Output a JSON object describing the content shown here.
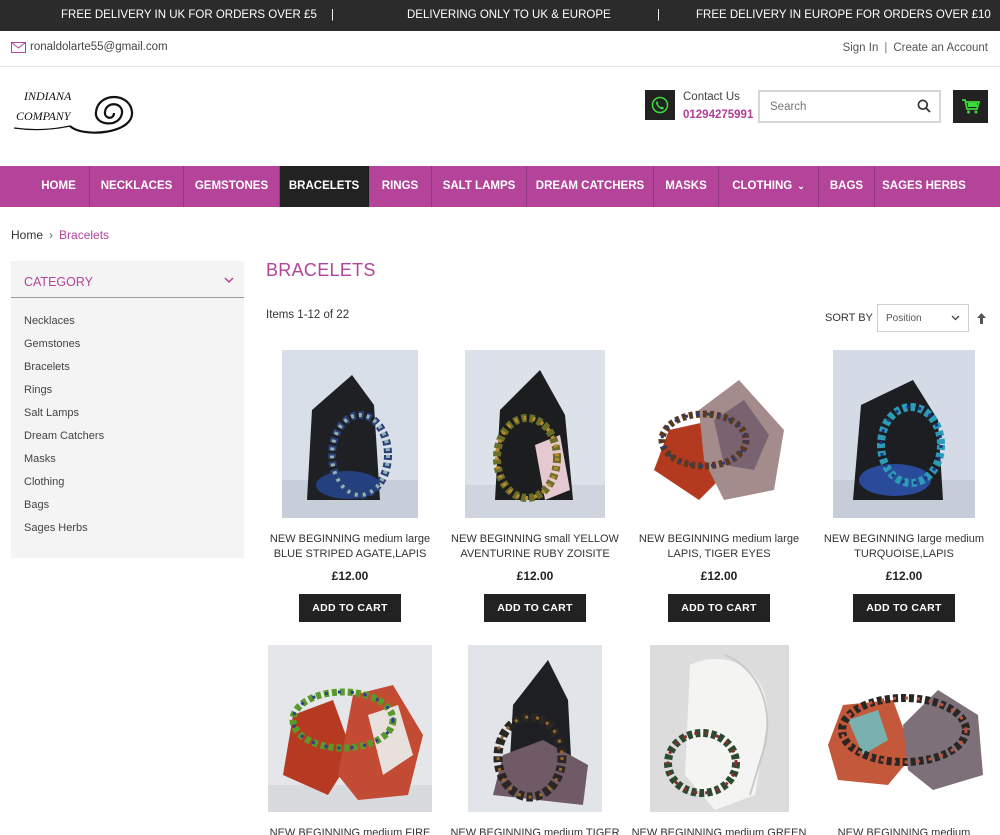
{
  "promo": {
    "left": "FREE DELIVERY IN UK FOR ORDERS OVER £5",
    "sep1": "|",
    "center": "DELIVERING ONLY TO UK & EUROPE",
    "sep2": "|",
    "right": "FREE DELIVERY IN EUROPE FOR ORDERS OVER £10"
  },
  "top": {
    "email": "ronaldolarte55@gmail.com",
    "sign_in": "Sign In",
    "sep": "|",
    "create_account": "Create an Account"
  },
  "header": {
    "contact_label": "Contact Us",
    "contact_phone": "01294275991",
    "search_placeholder": "Search"
  },
  "nav": [
    {
      "label": "HOME",
      "name": "nav-home"
    },
    {
      "label": "NECKLACES",
      "name": "nav-necklaces"
    },
    {
      "label": "GEMSTONES",
      "name": "nav-gemstones"
    },
    {
      "label": "BRACELETS",
      "name": "nav-bracelets",
      "active": true
    },
    {
      "label": "RINGS",
      "name": "nav-rings"
    },
    {
      "label": "SALT LAMPS",
      "name": "nav-salt-lamps"
    },
    {
      "label": "DREAM CATCHERS",
      "name": "nav-dream-catchers"
    },
    {
      "label": "MASKS",
      "name": "nav-masks"
    },
    {
      "label": "CLOTHING",
      "name": "nav-clothing",
      "dropdown": true
    },
    {
      "label": "BAGS",
      "name": "nav-bags"
    },
    {
      "label": "SAGES HERBS",
      "name": "nav-sages-herbs"
    }
  ],
  "breadcrumb": {
    "home": "Home",
    "current": "Bracelets"
  },
  "sidebar": {
    "title": "CATEGORY",
    "items": [
      "Necklaces",
      "Gemstones",
      "Bracelets",
      "Rings",
      "Salt Lamps",
      "Dream Catchers",
      "Masks",
      "Clothing",
      "Bags",
      "Sages Herbs"
    ]
  },
  "main": {
    "title": "BRACELETS",
    "items_count": "Items 1-12 of 22",
    "sort_label": "SORT BY",
    "sort_value": "Position"
  },
  "products": [
    {
      "name_line1": "NEW BEGINNING medium large",
      "name_line2": "BLUE STRIPED AGATE,LAPIS",
      "price": "£12.00",
      "cta": "ADD TO CART"
    },
    {
      "name_line1": "NEW BEGINNING small YELLOW",
      "name_line2": "AVENTURINE RUBY ZOISITE",
      "price": "£12.00",
      "cta": "ADD TO CART"
    },
    {
      "name_line1": "NEW BEGINNING medium large",
      "name_line2": "LAPIS, TIGER EYES",
      "price": "£12.00",
      "cta": "ADD TO CART"
    },
    {
      "name_line1": "NEW BEGINNING large medium",
      "name_line2": "TURQUOISE,LAPIS",
      "price": "£12.00",
      "cta": "ADD TO CART"
    },
    {
      "name_line1": "NEW BEGINNING medium FIRE",
      "name_line2": "",
      "price": "",
      "cta": ""
    },
    {
      "name_line1": "NEW BEGINNING medium TIGER",
      "name_line2": "",
      "price": "",
      "cta": ""
    },
    {
      "name_line1": "NEW BEGINNING medium GREEN",
      "name_line2": "",
      "price": "",
      "cta": ""
    },
    {
      "name_line1": "NEW BEGINNING medium",
      "name_line2": "",
      "price": "",
      "cta": ""
    }
  ],
  "colors": {
    "brand": "#b3449a",
    "dark": "#222222",
    "phone_icon": "#3ddc3d"
  }
}
